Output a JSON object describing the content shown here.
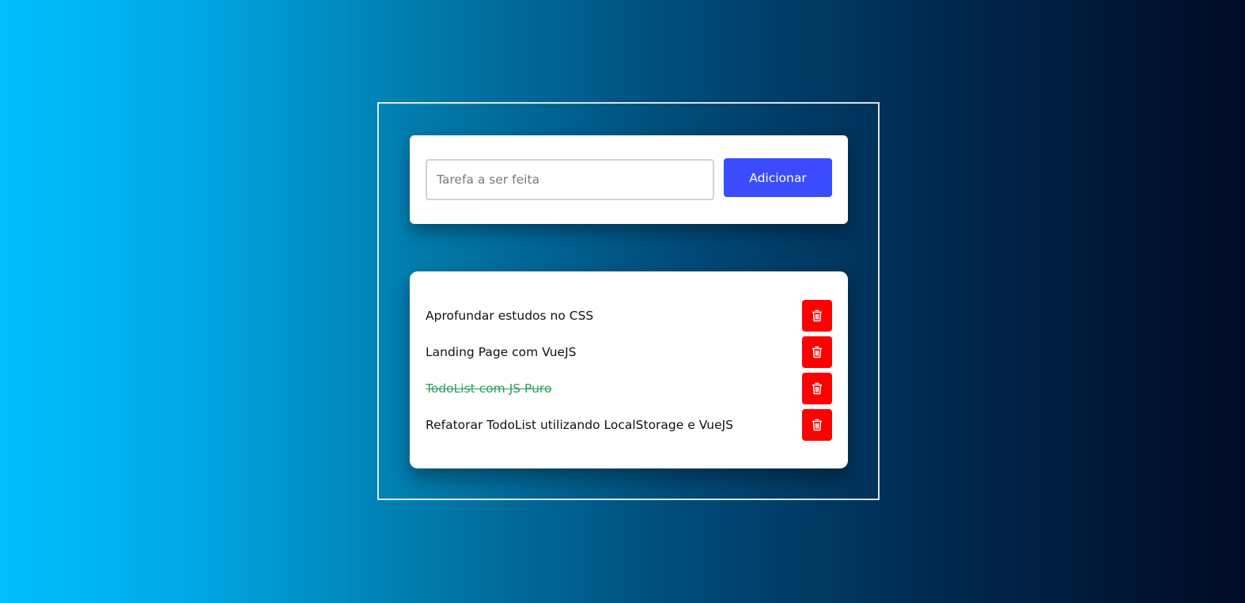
{
  "colors": {
    "accent": "#3b4cff",
    "delete": "#ff0000",
    "done_text": "#2e9e5e"
  },
  "form": {
    "input_value": "",
    "input_placeholder": "Tarefa a ser feita",
    "add_label": "Adicionar"
  },
  "tasks": [
    {
      "text": "Aprofundar estudos no CSS",
      "done": false,
      "icon": "trash-icon"
    },
    {
      "text": "Landing Page com VueJS",
      "done": false,
      "icon": "trash-icon"
    },
    {
      "text": "TodoList com JS Puro",
      "done": true,
      "icon": "trash-icon"
    },
    {
      "text": "Refatorar TodoList utilizando LocalStorage e VueJS",
      "done": false,
      "icon": "trash-icon"
    }
  ]
}
